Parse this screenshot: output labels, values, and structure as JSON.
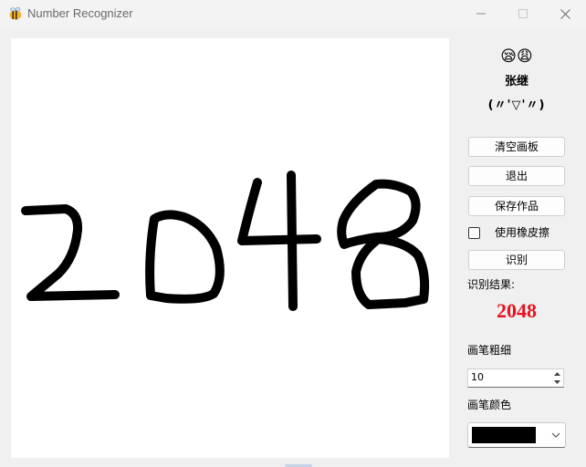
{
  "window": {
    "title": "Number Recognizer",
    "app_icon": "bee-icon",
    "controls": [
      "minimize-icon",
      "maximize-icon",
      "close-icon"
    ]
  },
  "canvas": {
    "background": "#ffffff",
    "ink_color": "#000000",
    "drawing_description_hidden": true
  },
  "panel": {
    "emoji": "😪😩",
    "author": "张继",
    "kaomoji": "(〃'▽'〃)",
    "buttons": {
      "clear": "清空画板",
      "exit": "退出",
      "save": "保存作品",
      "recognize": "识别"
    },
    "eraser": {
      "label": "使用橡皮擦",
      "checked": false
    },
    "result_label": "识别结果:",
    "result_value": "2048",
    "result_color": "#e8101c",
    "pen_size_label": "画笔粗细",
    "pen_size_value": "10",
    "pen_color_label": "画笔颜色",
    "pen_color_value": "#000000"
  }
}
